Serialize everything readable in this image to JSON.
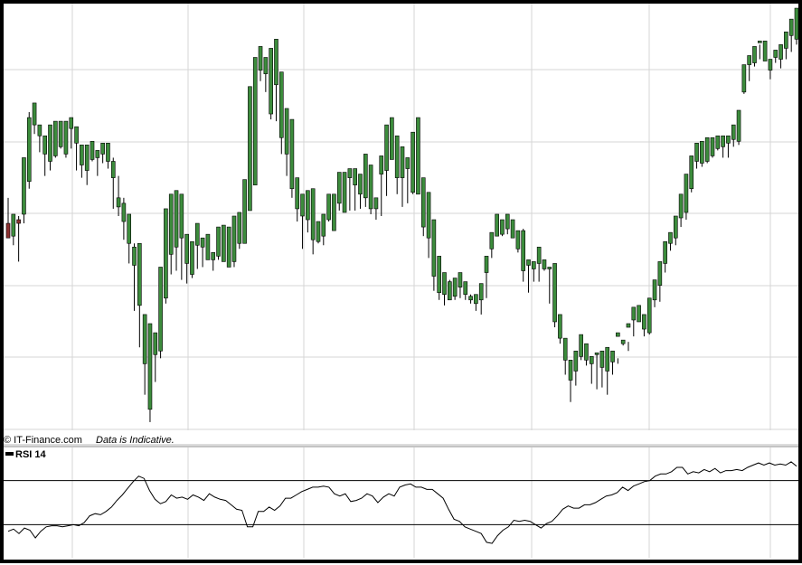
{
  "watermark": {
    "copyright": "© IT-Finance.com",
    "disclaimer": "Data is Indicative."
  },
  "indicator": {
    "label": "RSI 14"
  },
  "colors": {
    "bull": "#3c8c3c",
    "bear": "#8c3030",
    "wick": "#000000",
    "grid": "#d6d6d6",
    "frame": "#000000",
    "rsi_line": "#000000"
  },
  "chart_data": [
    {
      "type": "candlestick",
      "title": "",
      "y_axis": "unlabeled",
      "grid": true,
      "ohlc": [
        [
          174,
          188,
          170,
          166
        ],
        [
          167,
          175,
          162,
          179
        ],
        [
          176,
          178,
          153,
          174
        ],
        [
          179,
          194,
          174,
          210
        ],
        [
          197,
          235,
          193,
          232
        ],
        [
          228,
          237,
          223,
          240
        ],
        [
          222,
          224,
          213,
          228
        ],
        [
          212,
          213,
          200,
          222
        ],
        [
          208,
          209,
          203,
          228
        ],
        [
          211,
          225,
          210,
          230
        ],
        [
          216,
          226,
          215,
          230
        ],
        [
          212,
          228,
          210,
          230
        ],
        [
          226,
          228,
          215,
          232
        ],
        [
          218,
          223,
          203,
          227
        ],
        [
          206,
          211,
          199,
          217
        ],
        [
          203,
          208,
          195,
          217
        ],
        [
          209,
          217,
          208,
          219
        ],
        [
          210,
          212,
          200,
          214
        ],
        [
          212,
          215,
          207,
          218
        ],
        [
          208,
          214,
          204,
          218
        ],
        [
          199,
          210,
          182,
          208
        ],
        [
          183,
          200,
          178,
          188
        ],
        [
          175,
          188,
          165,
          185
        ],
        [
          163,
          178,
          152,
          179
        ],
        [
          151,
          163,
          126,
          161
        ],
        [
          129,
          160,
          106,
          163
        ],
        [
          97,
          121,
          80,
          124
        ],
        [
          72,
          104,
          65,
          119
        ],
        [
          102,
          110,
          87,
          114
        ],
        [
          104,
          125,
          100,
          150
        ],
        [
          133,
          170,
          130,
          182
        ],
        [
          157,
          167,
          146,
          190
        ],
        [
          161,
          185,
          148,
          192
        ],
        [
          166,
          189,
          143,
          190
        ],
        [
          152,
          157,
          141,
          168
        ],
        [
          146,
          161,
          144,
          164
        ],
        [
          162,
          166,
          149,
          174
        ],
        [
          161,
          163,
          150,
          166
        ],
        [
          154,
          160,
          155,
          168
        ],
        [
          154,
          156,
          148,
          158
        ],
        [
          156,
          160,
          154,
          172
        ],
        [
          153,
          164,
          160,
          173
        ],
        [
          150,
          158,
          152,
          172
        ],
        [
          153,
          166,
          150,
          178
        ],
        [
          163,
          170,
          160,
          180
        ],
        [
          163,
          181,
          174,
          198
        ],
        [
          181,
          221,
          198,
          249
        ],
        [
          195,
          215,
          257,
          265
        ],
        [
          258,
          265,
          252,
          271
        ],
        [
          256,
          262,
          246,
          265
        ],
        [
          234,
          262,
          231,
          270
        ],
        [
          250,
          265,
          230,
          275
        ],
        [
          221,
          251,
          212,
          257
        ],
        [
          212,
          228,
          200,
          237
        ],
        [
          193,
          221,
          188,
          231
        ],
        [
          182,
          198,
          175,
          199
        ],
        [
          178,
          186,
          160,
          190
        ],
        [
          176,
          182,
          169,
          192
        ],
        [
          165,
          185,
          157,
          193
        ],
        [
          164,
          170,
          163,
          175
        ],
        [
          167,
          172,
          162,
          179
        ],
        [
          176,
          180,
          175,
          190
        ],
        [
          170,
          178,
          174,
          190
        ],
        [
          185,
          192,
          181,
          202
        ],
        [
          180,
          198,
          190,
          202
        ],
        [
          199,
          200,
          181,
          204
        ],
        [
          195,
          204,
          181,
          204
        ],
        [
          190,
          199,
          182,
          201
        ],
        [
          188,
          204,
          183,
          212
        ],
        [
          182,
          190,
          179,
          206
        ],
        [
          182,
          186,
          176,
          188
        ],
        [
          201,
          205,
          178,
          211
        ],
        [
          203,
          221,
          189,
          228
        ],
        [
          209,
          227,
          210,
          232
        ],
        [
          199,
          218,
          190,
          222
        ],
        [
          199,
          203,
          183,
          216
        ],
        [
          204,
          208,
          185,
          210
        ],
        [
          191,
          211,
          190,
          224
        ],
        [
          190,
          212,
          193,
          232
        ],
        [
          172,
          194,
          167,
          199
        ],
        [
          166,
          188,
          155,
          191
        ],
        [
          145,
          170,
          137,
          176
        ],
        [
          136,
          152,
          132,
          156
        ],
        [
          135,
          145,
          129,
          147
        ],
        [
          132,
          143,
          135,
          142
        ],
        [
          134,
          140,
          132,
          144
        ],
        [
          139,
          144,
          133,
          147
        ],
        [
          135,
          138,
          132,
          142
        ],
        [
          132,
          135,
          130,
          134
        ],
        [
          130,
          134,
          126,
          135
        ],
        [
          132,
          139,
          124,
          141
        ],
        [
          147,
          152,
          133,
          156
        ],
        [
          160,
          165,
          155,
          169
        ],
        [
          167,
          179,
          169,
          179
        ],
        [
          168,
          176,
          167,
          176
        ],
        [
          171,
          176,
          168,
          179
        ],
        [
          166,
          176,
          172,
          176
        ],
        [
          160,
          169,
          158,
          170
        ],
        [
          148,
          171,
          142,
          170
        ],
        [
          151,
          152,
          136,
          154
        ],
        [
          149,
          152,
          142,
          153
        ],
        [
          152,
          158,
          142,
          161
        ],
        [
          149,
          152,
          148,
          154
        ],
        [
          149,
          150,
          130,
          150
        ],
        [
          120,
          151,
          117,
          152
        ],
        [
          111,
          118,
          108,
          124
        ],
        [
          99,
          110,
          91,
          111
        ],
        [
          88,
          95,
          76,
          99
        ],
        [
          93,
          97,
          85,
          104
        ],
        [
          101,
          110,
          99,
          113
        ],
        [
          99,
          104,
          96,
          108
        ],
        [
          97,
          100,
          86,
          101
        ],
        [
          102,
          103,
          83,
          103
        ],
        [
          95,
          100,
          84,
          104
        ],
        [
          93,
          106,
          80,
          106
        ],
        [
          98,
          101,
          91,
          104
        ],
        [
          112,
          100,
          97,
          114
        ],
        [
          108,
          109,
          107,
          110
        ],
        [
          117,
          109,
          104,
          119
        ],
        [
          121,
          124,
          112,
          128
        ],
        [
          120,
          123,
          121,
          129
        ],
        [
          116,
          121,
          112,
          124
        ],
        [
          114,
          127,
          113,
          133
        ],
        [
          132,
          137,
          128,
          143
        ],
        [
          140,
          146,
          131,
          153
        ],
        [
          152,
          161,
          147,
          164
        ],
        [
          163,
          163,
          159,
          169
        ],
        [
          166,
          170,
          162,
          178
        ],
        [
          177,
          187,
          172,
          190
        ],
        [
          180,
          189,
          176,
          201
        ],
        [
          193,
          203,
          191,
          211
        ],
        [
          208,
          214,
          204,
          218
        ],
        [
          207,
          219,
          205,
          219
        ],
        [
          208,
          221,
          207,
          221
        ],
        [
          211,
          218,
          210,
          221
        ],
        [
          215,
          221,
          214,
          222
        ],
        [
          216,
          219,
          210,
          222
        ],
        [
          218,
          219,
          210,
          222
        ],
        [
          220,
          228,
          216,
          228
        ],
        [
          219,
          228,
          217,
          236
        ],
        [
          246,
          260,
          245,
          261
        ],
        [
          261,
          262,
          252,
          266
        ],
        [
          262,
          270,
          260,
          271
        ],
        [
          273,
          272,
          264,
          274
        ],
        [
          263,
          272,
          265,
          274
        ],
        [
          258,
          260,
          253,
          264
        ],
        [
          265,
          266,
          262,
          269
        ],
        [
          264,
          270,
          259,
          272
        ],
        [
          270,
          275,
          264,
          279
        ],
        [
          277,
          283,
          268,
          286
        ],
        [
          275,
          290,
          272,
          292
        ]
      ],
      "ohlc_fields": [
        "open",
        "high",
        "low",
        "close"
      ],
      "ohlc_note": "price units arbitrary (no axis labels shown); candles listed left-to-right"
    },
    {
      "type": "line",
      "title": "RSI 14",
      "ylim": [
        0,
        100
      ],
      "reference_lines": [
        70,
        30
      ],
      "grid": true,
      "values": [
        24,
        26,
        22,
        27,
        25,
        18,
        24,
        28,
        29,
        29,
        28,
        29,
        30,
        29,
        32,
        38,
        40,
        39,
        42,
        46,
        52,
        57,
        63,
        69,
        74,
        72,
        61,
        53,
        49,
        51,
        57,
        54,
        55,
        53,
        57,
        55,
        52,
        58,
        55,
        53,
        52,
        48,
        44,
        43,
        28,
        28,
        42,
        42,
        46,
        43,
        47,
        54,
        54,
        57,
        60,
        62,
        64,
        64,
        65,
        64,
        58,
        56,
        58,
        51,
        52,
        54,
        58,
        56,
        50,
        55,
        58,
        56,
        64,
        66,
        67,
        64,
        64,
        62,
        62,
        58,
        54,
        44,
        35,
        33,
        28,
        26,
        24,
        22,
        14,
        13,
        20,
        25,
        28,
        34,
        33,
        34,
        33,
        30,
        27,
        31,
        33,
        38,
        44,
        47,
        45,
        45,
        48,
        48,
        50,
        53,
        56,
        57,
        59,
        64,
        61,
        65,
        67,
        69,
        70,
        74,
        76,
        76,
        78,
        82,
        82,
        76,
        78,
        77,
        80,
        78,
        81,
        77,
        79,
        79,
        80,
        79,
        82,
        84,
        86,
        84,
        86,
        84,
        85,
        84,
        87,
        83
      ]
    }
  ]
}
